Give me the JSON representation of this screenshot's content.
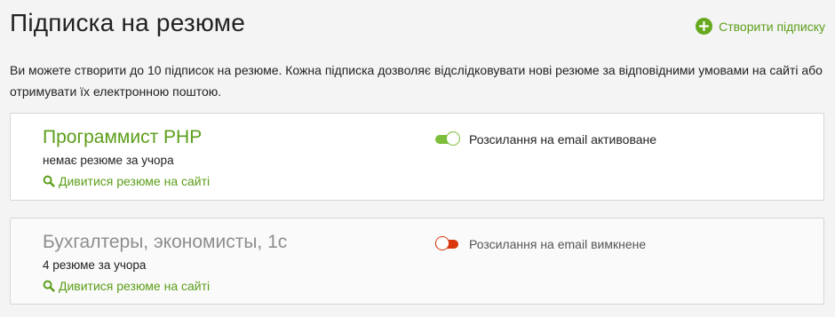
{
  "header": {
    "title": "Підписка на резюме",
    "create_label": "Створити підписку"
  },
  "intro": "Ви можете створити до 10 підписок на резюме. Кожна підписка дозволяє відслідковувати нові резюме за відповідними умовами на сайті або отримувати їх електронною поштою.",
  "subscriptions": [
    {
      "title": "Программист PHP",
      "summary": "немає резюме за учора",
      "link_label": "Дивитися резюме на сайті",
      "email_status": "Розсилання на email активоване",
      "email_enabled": true
    },
    {
      "title": "Бухгалтеры, экономисты, 1с",
      "summary": "4 резюме за учора",
      "link_label": "Дивитися резюме на сайті",
      "email_status": "Розсилання на email вимкнене",
      "email_enabled": false
    }
  ],
  "colors": {
    "accent": "#5c9e1a",
    "toggle_on": "#7cbd3a",
    "toggle_off": "#d9380d"
  },
  "icons": {
    "create": "plus-circle-icon",
    "link": "search-icon"
  }
}
